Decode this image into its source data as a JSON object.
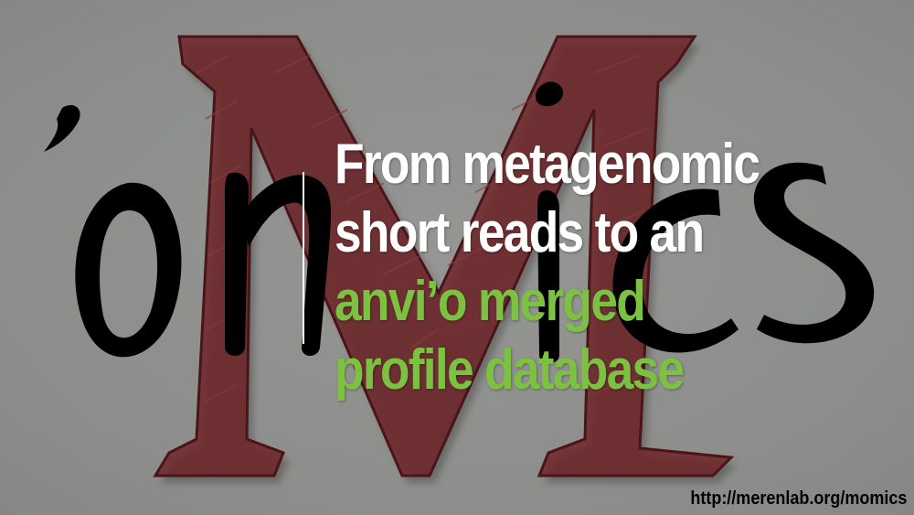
{
  "slide": {
    "title_lines": [
      "From metagenomic",
      "short reads to an",
      "anvi’o merged",
      "profile database"
    ],
    "url": "http://merenlab.org/momics"
  },
  "logo": {
    "letters": [
      "’",
      "o",
      "M",
      "i",
      "c",
      "s"
    ],
    "colors": {
      "ink": "#000000",
      "big_m": "#6e2226",
      "highlight": "#7dc142"
    }
  }
}
